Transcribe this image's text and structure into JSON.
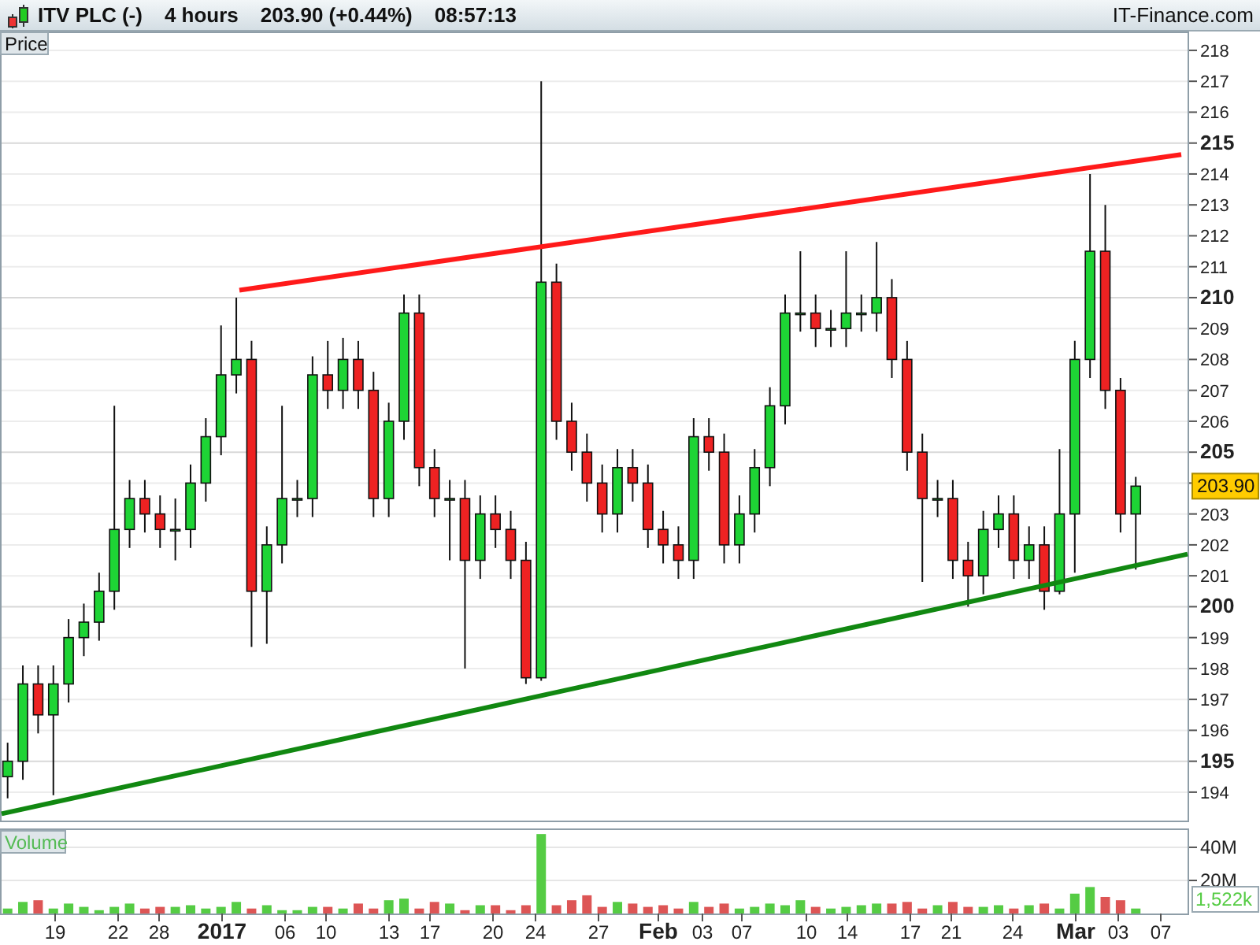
{
  "header": {
    "symbol": "ITV PLC (-)",
    "timeframe": "4 hours",
    "quote": "203.90 (+0.44%)",
    "time": "08:57:13",
    "site": "IT-Finance.com"
  },
  "price_pane": {
    "label": "Price",
    "last_price": "203.90",
    "chart_data": {
      "type": "candlestick",
      "grid": true,
      "ylim": [
        193.08,
        218.61
      ],
      "yticks": [
        218,
        217,
        216,
        215,
        214,
        213,
        212,
        211,
        210,
        209,
        208,
        207,
        206,
        205,
        203,
        202,
        201,
        200,
        199,
        198,
        197,
        196,
        195,
        194
      ],
      "categories": [
        null,
        null,
        null,
        null,
        null,
        null,
        null,
        null,
        null,
        null,
        null,
        null,
        null,
        null,
        null,
        null,
        null,
        null,
        null,
        null,
        null,
        null,
        null,
        null,
        null,
        null,
        null,
        null,
        null,
        null,
        null,
        null,
        null,
        null,
        null,
        null,
        null,
        null,
        null,
        null,
        null,
        null,
        null,
        null,
        null,
        null,
        null,
        null,
        null,
        null,
        null,
        null,
        null,
        null,
        null,
        null,
        null,
        null,
        null,
        null,
        null,
        null,
        null,
        null,
        null,
        null,
        null,
        null,
        null,
        null,
        null,
        null,
        null,
        null,
        null
      ],
      "ohlc": [
        [
          194.5,
          195.6,
          193.8,
          195
        ],
        [
          195,
          198.1,
          194.4,
          197.5
        ],
        [
          197.5,
          198.1,
          195.9,
          196.5
        ],
        [
          196.5,
          198.1,
          193.9,
          197.5
        ],
        [
          197.5,
          199.6,
          196.9,
          199
        ],
        [
          199,
          200.1,
          198.4,
          199.5
        ],
        [
          199.5,
          201.1,
          198.9,
          200.5
        ],
        [
          200.5,
          206.5,
          199.9,
          202.5
        ],
        [
          202.5,
          204.1,
          201.9,
          203.5
        ],
        [
          203.5,
          204.1,
          202.4,
          203
        ],
        [
          203,
          203.6,
          201.9,
          202.5
        ],
        [
          202.5,
          203.5,
          201.5,
          202.5
        ],
        [
          202.5,
          204.6,
          201.9,
          204
        ],
        [
          204,
          206.1,
          203.4,
          205.5
        ],
        [
          205.5,
          209.1,
          204.9,
          207.5
        ],
        [
          207.5,
          210,
          206.9,
          208
        ],
        [
          208,
          208.6,
          198.7,
          200.5
        ],
        [
          200.5,
          202.6,
          198.8,
          202
        ],
        [
          202,
          206.5,
          201.4,
          203.5
        ],
        [
          203.5,
          204.1,
          202.9,
          203.5
        ],
        [
          203.5,
          208.1,
          202.9,
          207.5
        ],
        [
          207.5,
          208.6,
          206.4,
          207
        ],
        [
          207,
          208.7,
          206.4,
          208
        ],
        [
          208,
          208.6,
          206.4,
          207
        ],
        [
          207,
          207.6,
          202.9,
          203.5
        ],
        [
          203.5,
          206.6,
          202.9,
          206
        ],
        [
          206,
          210.1,
          205.4,
          209.5
        ],
        [
          209.5,
          210.1,
          203.9,
          204.5
        ],
        [
          204.5,
          205.1,
          202.9,
          203.5
        ],
        [
          203.5,
          204.1,
          201.5,
          203.5
        ],
        [
          203.5,
          204.1,
          198,
          201.5
        ],
        [
          201.5,
          203.6,
          200.9,
          203
        ],
        [
          203,
          203.6,
          201.9,
          202.5
        ],
        [
          202.5,
          203.1,
          200.9,
          201.5
        ],
        [
          201.5,
          202.1,
          197.5,
          197.7
        ],
        [
          197.7,
          217,
          197.6,
          210.5
        ],
        [
          210.5,
          211.1,
          205.4,
          206
        ],
        [
          206,
          206.6,
          204.4,
          205
        ],
        [
          205,
          205.6,
          203.4,
          204
        ],
        [
          204,
          204.6,
          202.4,
          203
        ],
        [
          203,
          205.1,
          202.4,
          204.5
        ],
        [
          204.5,
          205.1,
          203.4,
          204
        ],
        [
          204,
          204.6,
          201.9,
          202.5
        ],
        [
          202.5,
          203.1,
          201.4,
          202
        ],
        [
          202,
          202.6,
          200.9,
          201.5
        ],
        [
          201.5,
          206.1,
          200.9,
          205.5
        ],
        [
          205.5,
          206.1,
          204.4,
          205
        ],
        [
          205,
          205.6,
          201.4,
          202
        ],
        [
          202,
          203.6,
          201.4,
          203
        ],
        [
          203,
          205.1,
          202.4,
          204.5
        ],
        [
          204.5,
          207.1,
          203.9,
          206.5
        ],
        [
          206.5,
          210.1,
          205.9,
          209.5
        ],
        [
          209.5,
          211.5,
          208.9,
          209.5
        ],
        [
          209.5,
          210.1,
          208.4,
          209
        ],
        [
          209,
          209.6,
          208.4,
          209
        ],
        [
          209,
          211.5,
          208.4,
          209.5
        ],
        [
          209.5,
          210.1,
          208.9,
          209.5
        ],
        [
          209.5,
          211.8,
          208.9,
          210
        ],
        [
          210,
          210.6,
          207.4,
          208
        ],
        [
          208,
          208.6,
          204.4,
          205
        ],
        [
          205,
          205.6,
          200.8,
          203.5
        ],
        [
          203.5,
          204.1,
          202.9,
          203.5
        ],
        [
          203.5,
          204.1,
          200.9,
          201.5
        ],
        [
          201.5,
          202.1,
          200,
          201
        ],
        [
          201,
          203.1,
          200.4,
          202.5
        ],
        [
          202.5,
          203.6,
          201.9,
          203
        ],
        [
          203,
          203.6,
          200.9,
          201.5
        ],
        [
          201.5,
          202.6,
          200.9,
          202
        ],
        [
          202,
          202.6,
          199.9,
          200.5
        ],
        [
          200.5,
          205.1,
          200.4,
          203
        ],
        [
          203,
          208.6,
          201.1,
          208
        ],
        [
          208,
          214,
          207.4,
          211.5
        ],
        [
          211.5,
          213,
          206.4,
          207
        ],
        [
          207,
          207.4,
          202.4,
          203
        ],
        [
          203,
          204.2,
          201.2,
          203.9
        ]
      ]
    }
  },
  "volume_pane": {
    "label": "Volume",
    "last_volume": "1,522k",
    "chart_data": {
      "type": "bar",
      "grid": true,
      "ylim": [
        0,
        51.4
      ],
      "yticks": [
        {
          "value": 20,
          "label": "20M"
        },
        {
          "value": 40,
          "label": "40M"
        }
      ],
      "values": [
        3,
        7,
        8,
        3,
        6,
        4,
        2,
        4,
        6,
        3,
        4,
        4,
        5,
        3,
        4,
        7,
        3,
        5,
        2,
        2,
        4,
        4,
        3,
        6,
        3,
        8,
        9,
        3,
        7,
        6,
        2,
        5,
        5,
        2,
        5,
        48,
        5,
        8,
        11,
        4,
        7,
        6,
        4,
        5,
        3,
        7,
        4,
        6,
        3,
        4,
        6,
        5,
        8,
        4,
        3,
        4,
        5,
        6,
        6,
        7,
        3,
        5,
        7,
        4,
        4,
        5,
        3,
        5,
        6,
        3,
        12,
        16,
        10,
        8,
        3,
        null,
        null,
        null
      ]
    }
  },
  "date_labels": [
    {
      "label": "19",
      "bold": false
    },
    {
      "label": "22",
      "bold": false
    },
    {
      "label": "28",
      "bold": false
    },
    {
      "label": "2017",
      "bold": true
    },
    {
      "label": "06",
      "bold": false
    },
    {
      "label": "10",
      "bold": false
    },
    {
      "label": "13",
      "bold": false
    },
    {
      "label": "17",
      "bold": false
    },
    {
      "label": "20",
      "bold": false
    },
    {
      "label": "24",
      "bold": false
    },
    {
      "label": "27",
      "bold": false
    },
    {
      "label": "Feb",
      "bold": true
    },
    {
      "label": "03",
      "bold": false
    },
    {
      "label": "07",
      "bold": false
    },
    {
      "label": "10",
      "bold": false
    },
    {
      "label": "14",
      "bold": false
    },
    {
      "label": "17",
      "bold": false
    },
    {
      "label": "21",
      "bold": false
    },
    {
      "label": "24",
      "bold": false
    },
    {
      "label": "Mar",
      "bold": true
    },
    {
      "label": "03",
      "bold": false
    },
    {
      "label": "07",
      "bold": false
    }
  ]
}
